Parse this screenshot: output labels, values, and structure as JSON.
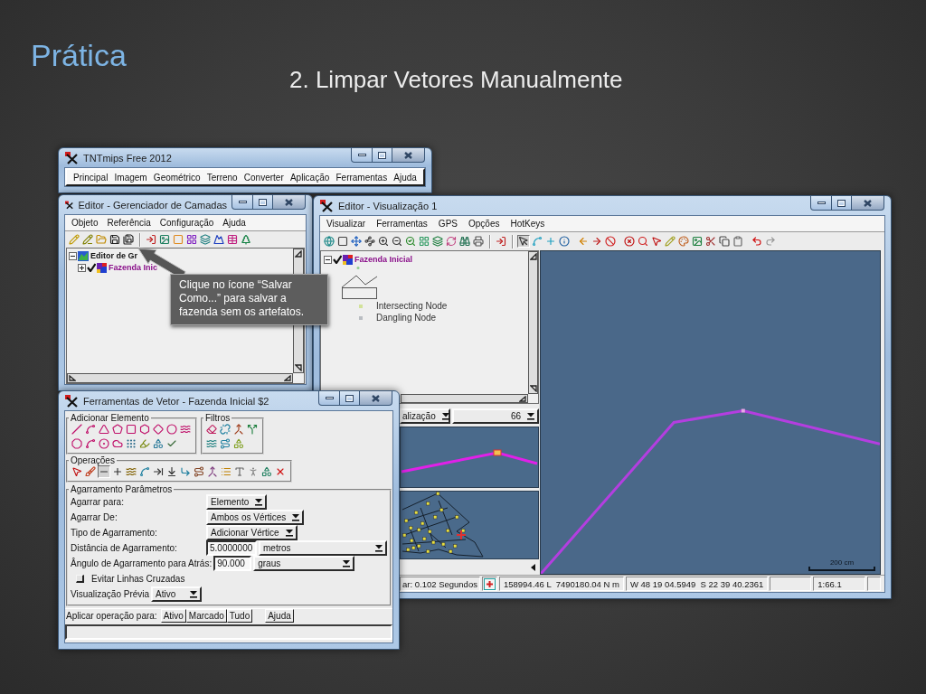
{
  "slide": {
    "title": "Prática",
    "subtitle": "2. Limpar Vetores Manualmente"
  },
  "main_window": {
    "title": "TNTmips Free 2012",
    "menu": [
      "Principal",
      "Imagem",
      "Geométrico",
      "Terreno",
      "Converter",
      "Aplicação",
      "Ferramentas",
      "Ajuda"
    ]
  },
  "layer_manager": {
    "title": "Editor - Gerenciador de Camadas",
    "menu": [
      "Objeto",
      "Referência",
      "Configuração",
      "Ajuda"
    ],
    "tree": [
      {
        "label": "Editor de Gr",
        "expanded": true,
        "children": [
          {
            "label": "Fazenda Inic",
            "expanded": false,
            "checked": true
          }
        ]
      }
    ]
  },
  "callout": {
    "text": "Clique no ícone “Salvar Como...” para salvar a fazenda sem os artefatos."
  },
  "view_window": {
    "title": "Editor - Visualização 1",
    "menu": [
      "Visualizar",
      "Ferramentas",
      "GPS",
      "Opções",
      "HotKeys"
    ],
    "tools": [
      {
        "selected": false
      },
      {
        "selected": false
      },
      {
        "selected": false
      },
      {
        "selected": false
      },
      {
        "selected": false
      },
      {
        "selected": false
      },
      {
        "selected": false
      },
      {
        "selected": false
      },
      {
        "selected": false
      },
      {
        "selected": false
      },
      {
        "selected": false
      },
      {
        "selected": false
      },
      {
        "selected": false
      },
      {
        "selected": true
      },
      {
        "selected": false
      },
      {
        "selected": false
      },
      {
        "selected": false
      },
      {
        "selected": false
      },
      {
        "selected": false
      },
      {
        "selected": false
      },
      {
        "selected": false
      },
      {
        "selected": false
      },
      {
        "selected": false
      },
      {
        "selected": false
      },
      {
        "selected": false
      },
      {
        "selected": false
      },
      {
        "selected": false
      },
      {
        "selected": false
      },
      {
        "selected": false
      },
      {
        "selected": false
      },
      {
        "selected": false
      }
    ],
    "legend": {
      "layer": {
        "label": "Fazenda Inicial",
        "expanded": true,
        "checked": true
      },
      "items": [
        {
          "label": "Intersecting Node",
          "color": "#d2e29a"
        },
        {
          "label": "Dangling Node",
          "color": "#b9bdc2"
        }
      ]
    },
    "view_select": {
      "value": "alização"
    },
    "zoom_select": {
      "value": "66"
    },
    "scale_bar": {
      "label": "200 cm"
    },
    "status_bar": [
      "ar: 0.102 Segundos",
      "158994.46 L  7490180.04 N m",
      "W 48 19 04.5949  S 22 39 40.2361",
      "1:66.1"
    ]
  },
  "vector_tools": {
    "title": "Ferramentas de Vetor - Fazenda Inicial $2",
    "add_element": {
      "label": "Adicionar Elemento"
    },
    "filters": {
      "label": "Filtros"
    },
    "operations": {
      "label": "Operações",
      "tools": [
        {
          "selected": false
        },
        {
          "selected": false
        },
        {
          "selected": true
        },
        {
          "selected": false
        },
        {
          "selected": false
        },
        {
          "selected": false
        },
        {
          "selected": false
        },
        {
          "selected": false
        },
        {
          "selected": false
        },
        {
          "selected": false
        },
        {
          "selected": false
        },
        {
          "selected": false
        },
        {
          "selected": false
        },
        {
          "selected": false
        },
        {
          "selected": false
        },
        {
          "selected": false
        }
      ]
    },
    "snap": {
      "label": "Agarramento Parâmetros",
      "rows": [
        {
          "kind": "select",
          "label": "Agarrar para:",
          "value": "Elemento"
        },
        {
          "kind": "select",
          "label": "Agarrar De:",
          "value": "Ambos os Vértices"
        },
        {
          "kind": "select",
          "label": "Tipo de Agarramento:",
          "value": "Adicionar Vértice"
        },
        {
          "kind": "measure",
          "label": "Distância de Agarramento:",
          "value": "5.0000000",
          "unit": "metros"
        },
        {
          "kind": "measure",
          "label": "Ângulo de Agarramento para Atrás:",
          "value": "90.000",
          "unit": "graus"
        },
        {
          "kind": "checkbox",
          "label": "Evitar Linhas Cruzadas",
          "checked": false
        }
      ],
      "preview": {
        "label": "Visualização Prévia",
        "value": "Ativo"
      }
    },
    "apply": {
      "label": "Aplicar operação para:",
      "buttons": [
        "Ativo",
        "Marcado",
        "Tudo",
        "Ajuda"
      ]
    }
  }
}
